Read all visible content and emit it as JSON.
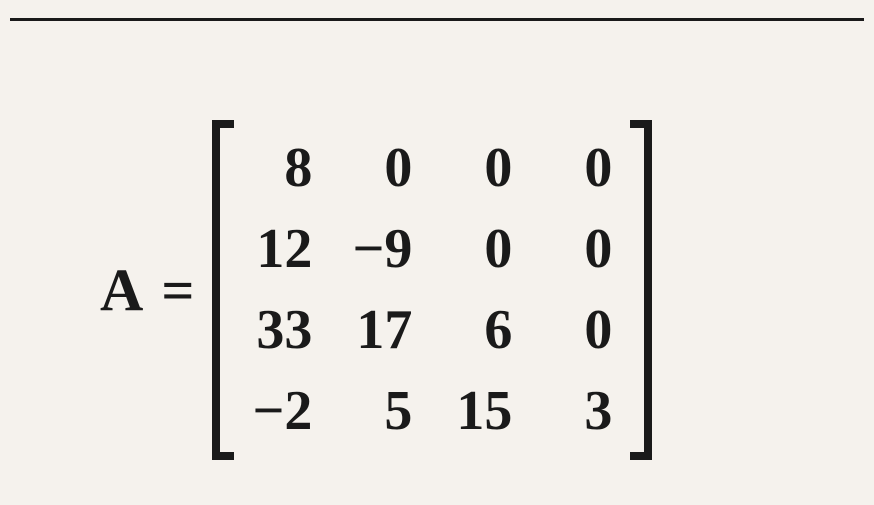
{
  "equation": {
    "variable": "A",
    "operator": "="
  },
  "matrix": {
    "rows": [
      [
        "8",
        "0",
        "0",
        "0"
      ],
      [
        "12",
        "−9",
        "0",
        "0"
      ],
      [
        "33",
        "17",
        "6",
        "0"
      ],
      [
        "−2",
        "5",
        "15",
        "3"
      ]
    ]
  }
}
